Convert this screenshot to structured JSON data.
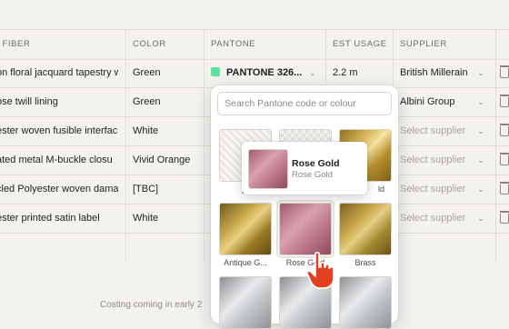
{
  "columns": {
    "fiber": "/ FIBER",
    "color": "COLOR",
    "pantone": "PANTONE",
    "usage": "EST USAGE",
    "supplier": "SUPPLIER"
  },
  "rows": [
    {
      "fiber": "on floral jacquard tapestry w",
      "color": "Green",
      "pantone": "PANTONE 326...",
      "pantone_swatch": "#5fe2a1",
      "usage": "2.2 m",
      "supplier": "British Millerain",
      "supplier_placeholder": false
    },
    {
      "fiber": "ose twill lining",
      "color": "Green",
      "pantone": "",
      "usage": "",
      "supplier": "Albini Group",
      "supplier_placeholder": false
    },
    {
      "fiber": "ester woven fusible interfac",
      "color": "White",
      "pantone": "",
      "usage": "",
      "supplier": "Select supplier",
      "supplier_placeholder": true
    },
    {
      "fiber": "ated metal M-buckle closu",
      "color": "Vivid Orange",
      "pantone": "",
      "usage": "",
      "supplier": "Select supplier",
      "supplier_placeholder": true
    },
    {
      "fiber": "cled Polyester woven dama",
      "color": "[TBC]",
      "pantone": "",
      "usage": "",
      "supplier": "Select supplier",
      "supplier_placeholder": true
    },
    {
      "fiber": "ester printed satin label",
      "color": "White",
      "pantone": "",
      "usage": "",
      "supplier": "Select supplier",
      "supplier_placeholder": true
    }
  ],
  "footer": "Costing coming in early 2",
  "dropdown": {
    "search_placeholder": "Search Pantone code or colour",
    "tiles": [
      {
        "label": "[T",
        "texture": "tex-light"
      },
      {
        "label": "",
        "texture": "tex-check"
      },
      {
        "label": "ld",
        "texture": "gold"
      },
      {
        "label": "Antique G...",
        "texture": "antique"
      },
      {
        "label": "Rose Gold",
        "texture": "rose"
      },
      {
        "label": "Brass",
        "texture": "brass"
      },
      {
        "label": "",
        "texture": "silver"
      },
      {
        "label": "",
        "texture": "silver"
      },
      {
        "label": "",
        "texture": "silver"
      }
    ]
  },
  "tooltip": {
    "name": "Rose Gold",
    "sub": "Rose Gold"
  },
  "colors": {
    "accent_swatch": "#5fe2a1",
    "cursor": "#e0401f"
  }
}
